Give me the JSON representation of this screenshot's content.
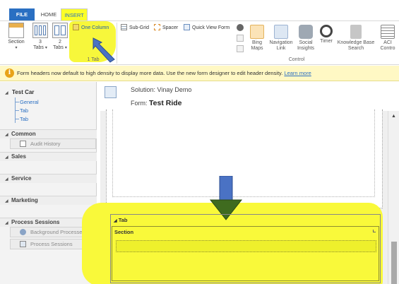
{
  "ribbon_tabs": {
    "file": "FILE",
    "home": "HOME",
    "insert": "INSERT"
  },
  "ribbon": {
    "section": {
      "label": "Section",
      "dropdown": "▾"
    },
    "three_tabs": {
      "line1": "3",
      "line2": "Tabs",
      "dropdown": "▾"
    },
    "two_tabs": {
      "line1": "2",
      "line2": "Tabs",
      "dropdown": "▾"
    },
    "one_column": "One Column",
    "group_1tab": "1 Tab",
    "sub_grid": "Sub-Grid",
    "spacer": "Spacer",
    "quick_view_form": "Quick View Form",
    "bing_maps": {
      "line1": "Bing",
      "line2": "Maps"
    },
    "navigation_link": {
      "line1": "Navigation",
      "line2": "Link"
    },
    "social_insights": {
      "line1": "Social",
      "line2": "Insights"
    },
    "timer": "Timer",
    "knowledge_base_search": {
      "line1": "Knowledge Base",
      "line2": "Search"
    },
    "aci_control": {
      "line1": "ACI",
      "line2": "Contro"
    },
    "group_control": "Control"
  },
  "notice": {
    "text": "Form headers now default to high density to display more data. Use the new form designer to edit header density.",
    "link": "Learn more"
  },
  "leftnav": {
    "entity": "Test Car",
    "links": [
      "General",
      "Tab",
      "Tab"
    ],
    "categories": {
      "common": "Common",
      "sales": "Sales",
      "service": "Service",
      "marketing": "Marketing",
      "process_sessions": "Process Sessions"
    },
    "audit_history": "Audit History",
    "background_processes": "Background Processes",
    "process_sessions_item": "Process Sessions"
  },
  "form": {
    "solution_label": "Solution: Vinay Demo",
    "form_prefix": "Form:",
    "form_name": "Test Ride",
    "tab_label": "Tab",
    "section_label": "Section"
  },
  "colors": {
    "highlight": "#f9f93a",
    "arrow_blue": "#4a72c4",
    "arrow_green": "#3f6b1f",
    "file_tab": "#2a6fc2"
  }
}
